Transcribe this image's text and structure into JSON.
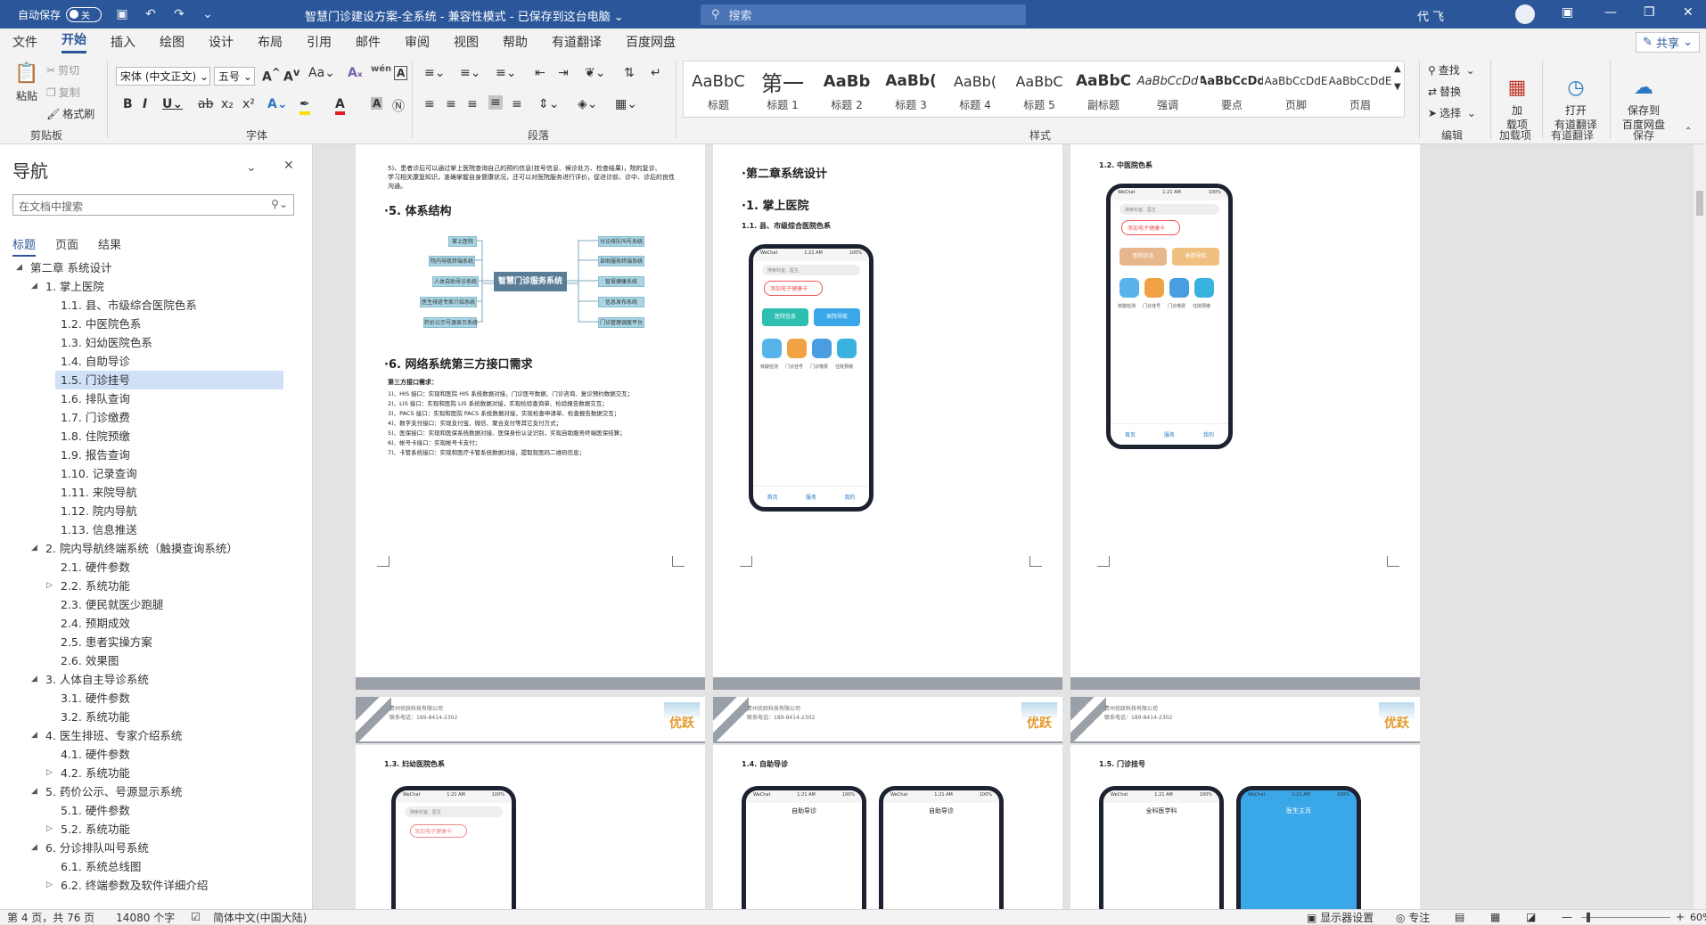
{
  "titlebar": {
    "autosave_label": "自动保存",
    "autosave_state": "关",
    "title": "智慧门诊建设方案-全系统  -  兼容性模式 - 已保存到这台电脑",
    "search_placeholder": "搜索",
    "user": "代 飞"
  },
  "menu": [
    "文件",
    "开始",
    "插入",
    "绘图",
    "设计",
    "布局",
    "引用",
    "邮件",
    "审阅",
    "视图",
    "帮助",
    "有道翻译",
    "百度网盘"
  ],
  "share_label": "共享",
  "ribbon": {
    "clipboard": {
      "paste": "粘贴",
      "cut": "剪切",
      "copy": "复制",
      "painter": "格式刷",
      "label": "剪贴板"
    },
    "font": {
      "name": "宋体 (中文正文)",
      "size": "五号",
      "label": "字体"
    },
    "paragraph_label": "段落",
    "styles": [
      {
        "preview": "AaBbC",
        "name": "标题"
      },
      {
        "preview": "第一",
        "name": "标题 1"
      },
      {
        "preview": "AaBb",
        "name": "标题 2"
      },
      {
        "preview": "AaBb(",
        "name": "标题 3"
      },
      {
        "preview": "AaBb(",
        "name": "标题 4"
      },
      {
        "preview": "AaBbC",
        "name": "标题 5"
      },
      {
        "preview": "AaBbC",
        "name": "副标题"
      },
      {
        "preview": "AaBbCcDd",
        "name": "强调"
      },
      {
        "preview": "AaBbCcDd",
        "name": "要点"
      },
      {
        "preview": "AaBbCcDdE",
        "name": "页脚"
      },
      {
        "preview": "AaBbCcDdE",
        "name": "页眉"
      }
    ],
    "styles_label": "样式",
    "editing": {
      "find": "查找",
      "replace": "替换",
      "select": "选择",
      "label": "编辑"
    },
    "addins": {
      "btn": "加\n载项",
      "label": "加载项"
    },
    "youdao": {
      "btn": "打开\n有道翻译",
      "label": "有道翻译"
    },
    "baidu": {
      "btn": "保存到\n百度网盘",
      "label": "保存"
    }
  },
  "nav": {
    "title": "导航",
    "search_placeholder": "在文档中搜索",
    "tabs": [
      "标题",
      "页面",
      "结果"
    ],
    "items": [
      {
        "level": 0,
        "text": "第二章 系统设计",
        "exp": "open"
      },
      {
        "level": 1,
        "text": "1. 掌上医院",
        "exp": "open"
      },
      {
        "level": 2,
        "text": "1.1. 县、市级综合医院色系"
      },
      {
        "level": 2,
        "text": "1.2. 中医院色系"
      },
      {
        "level": 2,
        "text": "1.3. 妇幼医院色系"
      },
      {
        "level": 2,
        "text": "1.4. 自助导诊"
      },
      {
        "level": 2,
        "text": "1.5. 门诊挂号",
        "sel": true
      },
      {
        "level": 2,
        "text": "1.6. 排队查询"
      },
      {
        "level": 2,
        "text": "1.7. 门诊缴费"
      },
      {
        "level": 2,
        "text": "1.8. 住院预缴"
      },
      {
        "level": 2,
        "text": "1.9. 报告查询"
      },
      {
        "level": 2,
        "text": "1.10. 记录查询"
      },
      {
        "level": 2,
        "text": "1.11. 来院导航"
      },
      {
        "level": 2,
        "text": "1.12. 院内导航"
      },
      {
        "level": 2,
        "text": "1.13. 信息推送"
      },
      {
        "level": 1,
        "text": "2. 院内导航终端系统（触摸查询系统）",
        "exp": "open"
      },
      {
        "level": 2,
        "text": "2.1. 硬件参数"
      },
      {
        "level": 2,
        "text": "2.2. 系统功能",
        "exp": "closed"
      },
      {
        "level": 2,
        "text": "2.3. 便民就医少跑腿"
      },
      {
        "level": 2,
        "text": "2.4. 预期成效"
      },
      {
        "level": 2,
        "text": "2.5. 患者实操方案"
      },
      {
        "level": 2,
        "text": "2.6. 效果图"
      },
      {
        "level": 1,
        "text": "3. 人体自主导诊系统",
        "exp": "open"
      },
      {
        "level": 2,
        "text": "3.1. 硬件参数"
      },
      {
        "level": 2,
        "text": "3.2. 系统功能"
      },
      {
        "level": 1,
        "text": "4. 医生排班、专家介绍系统",
        "exp": "open"
      },
      {
        "level": 2,
        "text": "4.1. 硬件参数"
      },
      {
        "level": 2,
        "text": "4.2. 系统功能",
        "exp": "closed"
      },
      {
        "level": 1,
        "text": "5. 药价公示、号源显示系统",
        "exp": "open"
      },
      {
        "level": 2,
        "text": "5.1. 硬件参数"
      },
      {
        "level": 2,
        "text": "5.2. 系统功能",
        "exp": "closed"
      },
      {
        "level": 1,
        "text": "6. 分诊排队叫号系统",
        "exp": "open"
      },
      {
        "level": 2,
        "text": "6.1. 系统总线图"
      },
      {
        "level": 2,
        "text": "6.2. 终端参数及软件详细介绍",
        "exp": "closed"
      }
    ]
  },
  "pages": {
    "p1": {
      "intro": "5)、患者诊后可以通过掌上医院查询自己的预约信息(挂号信息、候诊处方、检查结果)，院的复诊、",
      "intro2": "学习相关康复知识，准确掌握自身健康状况，还可以对医院服务进行评价，促进诊前、诊中、诊后的良性",
      "intro3": "沟通。",
      "h5": "·5.  体系结构",
      "center": "智慧门诊服务系统",
      "left_nodes": [
        "掌上医院",
        "院内导航终端系统",
        "人体自助导诊系统",
        "医生排班专家介绍系统",
        "药价公示号源显示系统"
      ],
      "right_nodes": [
        "分诊排队叫号系统",
        "自助服务终端系统",
        "智慧健康系统",
        "信息发布系统",
        "门诊管理调度平台"
      ],
      "h6": "·6.  网络系统第三方接口需求",
      "iface_title": "第三方接口需求：",
      "iface": [
        "1)、HIS 接口：实现和医院 HIS 系统数据对接，门诊医号数据、门诊咨询、复诊预约数据交互；",
        "2)、LIS 接口：实现和医院 LIS 系统数据对接，实现检验查询单、检验报告数据交互；",
        "3)、PACS 接口：实现和医院 PACS 系统数据对接，实现检查申请单、检查报告数据交互；",
        "4)、数字支付接口：实现支付宝、微信、聚合支付等其它支付方式；",
        "5)、医保接口：实现和医保系统数据对接、医保身份认证识别，实现自助服务终端医保结算；",
        "6)、帐号卡接口：实现帐号卡支付；",
        "7)、卡管系统接口：实现和医疗卡管系统数据对接，提取就医码二维码信息；"
      ]
    },
    "p2": {
      "chapter": "·第二章系统设计",
      "h1": "·1.  掌上医院",
      "h11": "1.1.   县、市级综合医院色系"
    },
    "p3": {
      "h12": "1.2.   中医院色系"
    },
    "footer_company": "贵州优跃科技有限公司",
    "footer_phone": "联系电话：189-8414-2302",
    "footer_logo": "优跃",
    "p4": {
      "h13": "1.3.   妇幼医院色系"
    },
    "p5": {
      "h14": "1.4.   自助导诊",
      "screen_title": "自助导诊"
    },
    "p6": {
      "h15": "1.5.   门诊挂号",
      "screen_title": "全科医学科",
      "screen_title2": "医生主页"
    },
    "phone": {
      "carrier": "WeChat",
      "time": "1:21 AM",
      "battery": "100%",
      "search": "搜索科室、医生",
      "card": "添加电子健康卡",
      "hosp_info": "医院信息",
      "nav": "来院导航",
      "icons": [
        "核酸检测",
        "门诊挂号",
        "门诊缴费",
        "住院预缴"
      ],
      "tabs": [
        "首页",
        "服务",
        "我的"
      ]
    }
  },
  "statusbar": {
    "page": "第 4 页，共 76 页",
    "words": "14080 个字",
    "lang": "简体中文(中国大陆)",
    "display": "显示器设置",
    "focus": "专注",
    "zoom": "60%"
  }
}
